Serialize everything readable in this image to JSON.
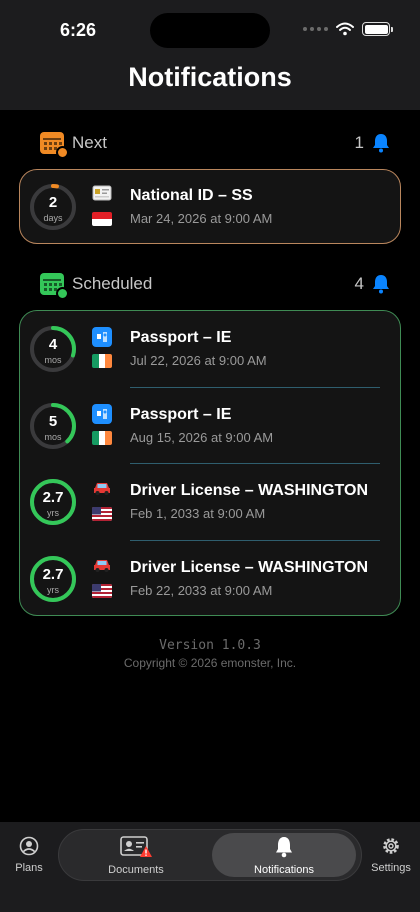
{
  "status_bar": {
    "time": "6:26"
  },
  "header": {
    "title": "Notifications"
  },
  "colors": {
    "orange": "#f08a24",
    "green": "#34c759",
    "bell_blue": "#0a84ff",
    "next_border": "#b9865d",
    "sched_border": "#3f8b54"
  },
  "next": {
    "label": "Next",
    "count": "1",
    "items": [
      {
        "num": "2",
        "unit": "days",
        "progress": 0.03,
        "ring_color": "#f08a24",
        "doc_icon": "id-card-icon",
        "flag": "indonesia-flag-icon",
        "title": "National ID – SS",
        "date": "Mar 24, 2026 at 9:00 AM"
      }
    ]
  },
  "scheduled": {
    "label": "Scheduled",
    "count": "4",
    "items": [
      {
        "num": "4",
        "unit": "mos",
        "progress": 0.3,
        "ring_color": "#34c759",
        "doc_icon": "passport-icon",
        "flag": "ireland-flag-icon",
        "title": "Passport – IE",
        "date": "Jul 22, 2026 at 9:00 AM"
      },
      {
        "num": "5",
        "unit": "mos",
        "progress": 0.38,
        "ring_color": "#34c759",
        "doc_icon": "passport-icon",
        "flag": "ireland-flag-icon",
        "title": "Passport – IE",
        "date": "Aug 15, 2026 at 9:00 AM"
      },
      {
        "num": "2.7",
        "unit": "yrs",
        "progress": 1.0,
        "ring_color": "#34c759",
        "doc_icon": "car-icon",
        "flag": "us-flag-icon",
        "title": "Driver License – WASHINGTON",
        "date": "Feb 1, 2033 at 9:00 AM"
      },
      {
        "num": "2.7",
        "unit": "yrs",
        "progress": 1.0,
        "ring_color": "#34c759",
        "doc_icon": "car-icon",
        "flag": "us-flag-icon",
        "title": "Driver License – WASHINGTON",
        "date": "Feb 22, 2033 at 9:00 AM"
      }
    ]
  },
  "footer": {
    "version": "Version 1.0.3",
    "copyright": "Copyright © 2026 emonster, Inc."
  },
  "tabs": {
    "plans": "Plans",
    "documents": "Documents",
    "notifications": "Notifications",
    "settings": "Settings"
  }
}
